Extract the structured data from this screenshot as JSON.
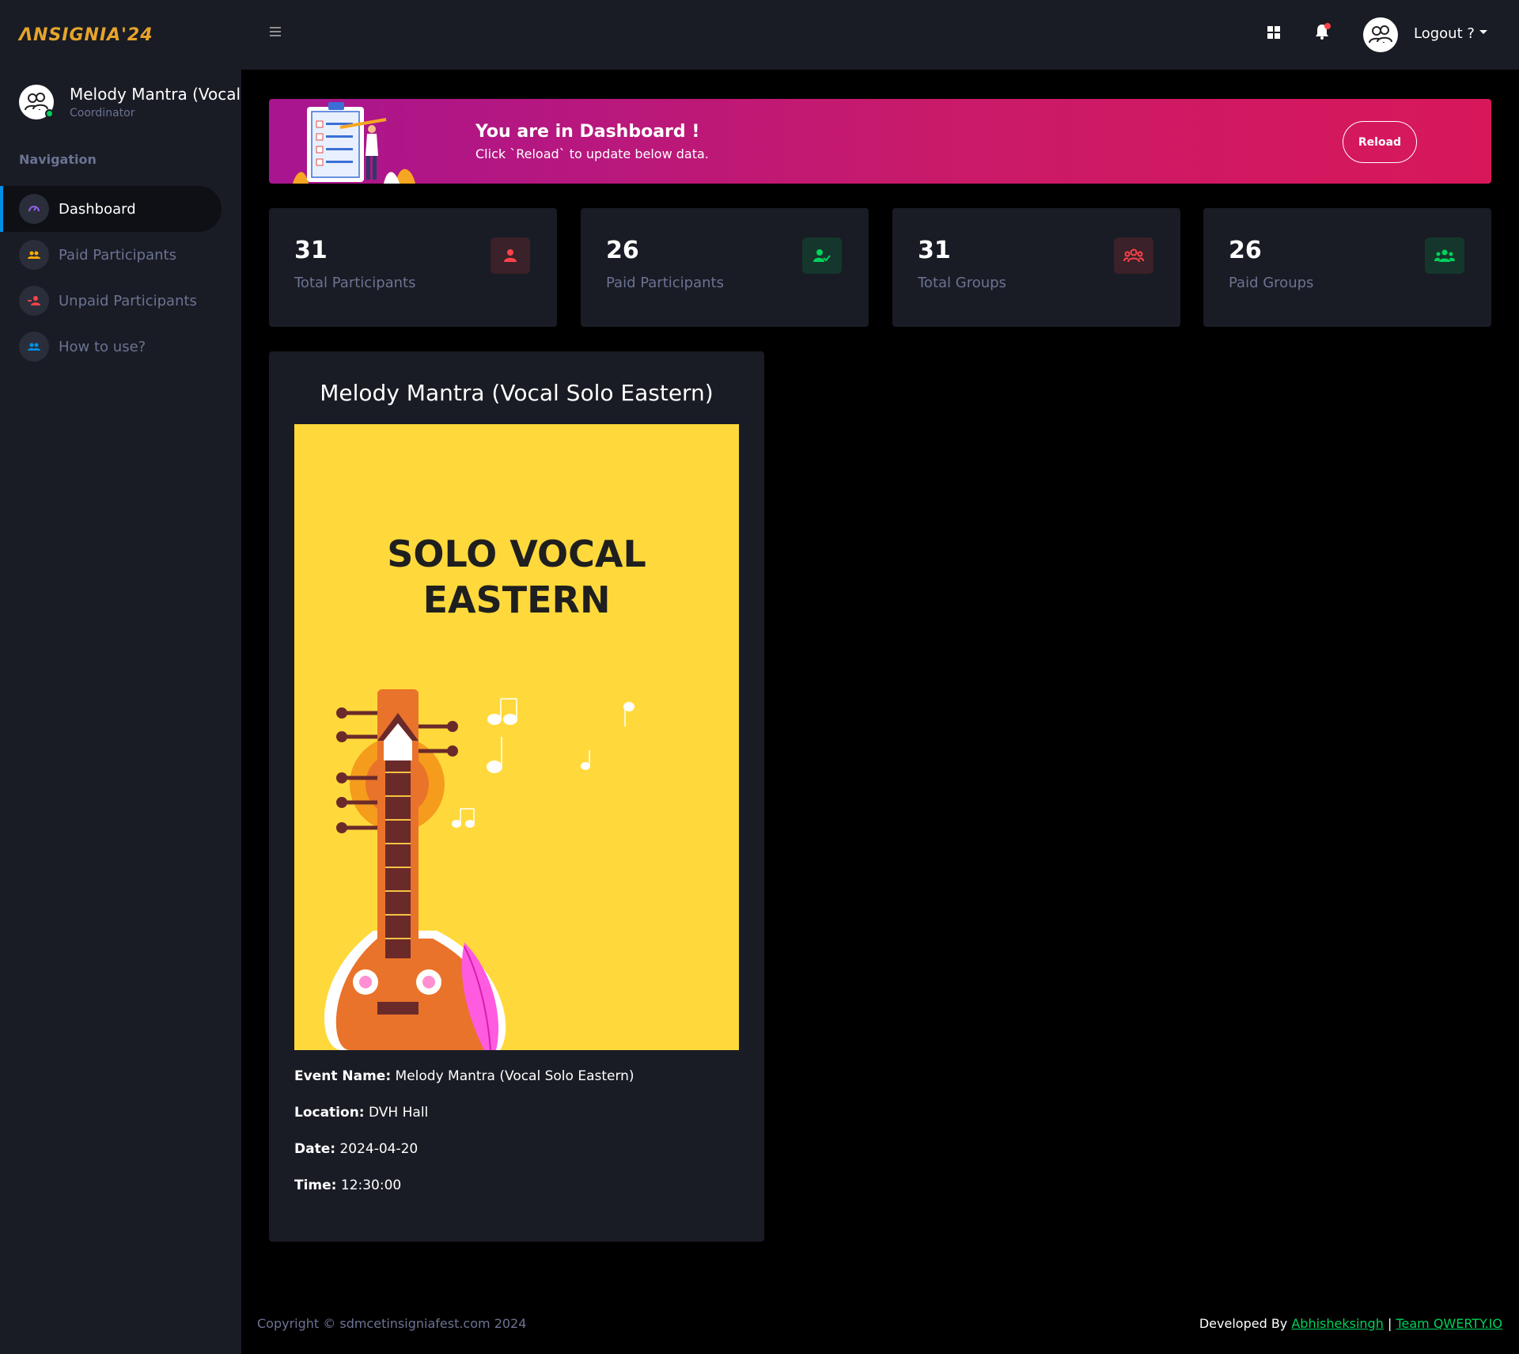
{
  "brand": {
    "logo_text": "ɅNSIGNIA'24"
  },
  "profile": {
    "name": "Melody Mantra (Vocal Solo Eastern)",
    "role": "Coordinator"
  },
  "nav": {
    "category": "Navigation",
    "items": [
      {
        "label": "Dashboard",
        "icon": "speedometer-icon",
        "active": true
      },
      {
        "label": "Paid Participants",
        "icon": "group-icon"
      },
      {
        "label": "Unpaid Participants",
        "icon": "user-remove-icon"
      },
      {
        "label": "How to use?",
        "icon": "people-icon"
      }
    ]
  },
  "topbar": {
    "logout_label": "Logout ?"
  },
  "banner": {
    "title": "You are in Dashboard !",
    "subtitle": "Click `Reload` to update below data.",
    "button_label": "Reload"
  },
  "stats": [
    {
      "value": "31",
      "label": "Total Participants",
      "color": "#fc424a"
    },
    {
      "value": "26",
      "label": "Paid Participants",
      "color": "#00d25b"
    },
    {
      "value": "31",
      "label": "Total Groups",
      "color": "#fc424a"
    },
    {
      "value": "26",
      "label": "Paid Groups",
      "color": "#00d25b"
    }
  ],
  "event": {
    "title": "Melody Mantra (Vocal Solo Eastern)",
    "poster_line1": "SOLO VOCAL",
    "poster_line2": "EASTERN",
    "name_label": "Event Name:",
    "name": "Melody Mantra (Vocal Solo Eastern)",
    "location_label": "Location:",
    "location": "DVH Hall",
    "date_label": "Date:",
    "date": "2024-04-20",
    "time_label": "Time:",
    "time": "12:30:00"
  },
  "footer": {
    "copyright": "Copyright © sdmcetinsigniafest.com 2024",
    "developed_by": "Developed By",
    "developer": "Abhisheksingh",
    "separator": "|",
    "team": "Team QWERTY.IO"
  },
  "colors": {
    "sidebar_bg": "#191c24",
    "accent_blue": "#0090e7",
    "danger": "#fc424a",
    "success": "#00d25b",
    "brand_gold": "#e6a42b",
    "poster_yellow": "#ffd93b"
  }
}
